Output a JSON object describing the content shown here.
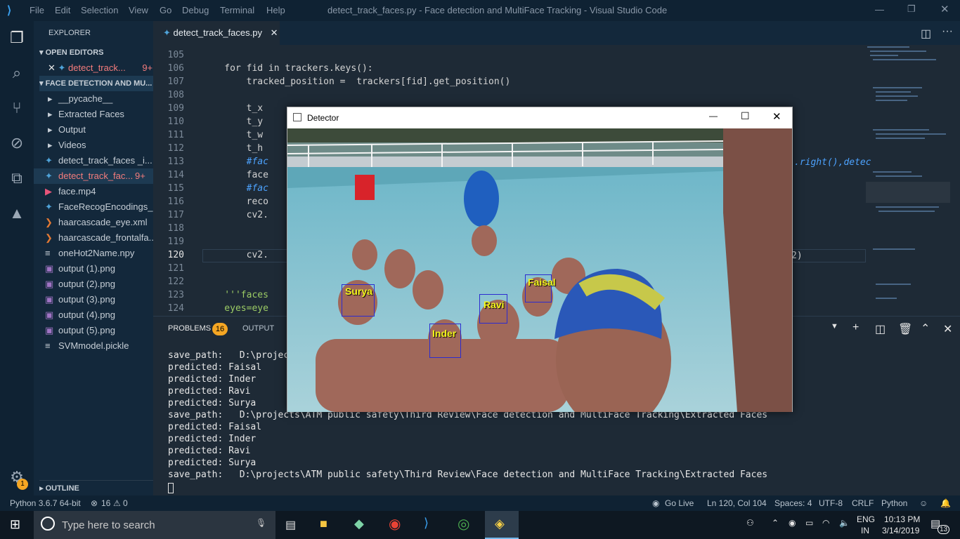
{
  "window": {
    "menu": [
      "File",
      "Edit",
      "Selection",
      "View",
      "Go",
      "Debug",
      "Terminal",
      "Help"
    ],
    "title": "detect_track_faces.py - Face detection and MultiFace Tracking - Visual Studio Code"
  },
  "sidebar": {
    "header": "EXPLORER",
    "open_editors_label": "OPEN EDITORS",
    "open_editor_file": "detect_track...",
    "open_editor_badge": "9+",
    "project_label": "FACE DETECTION AND MU...",
    "items": [
      {
        "label": "__pycache__",
        "icon": "chevron-right"
      },
      {
        "label": "Extracted Faces",
        "icon": "chevron-right"
      },
      {
        "label": "Output",
        "icon": "chevron-right"
      },
      {
        "label": "Videos",
        "icon": "chevron-right"
      },
      {
        "label": "detect_track_faces _i...",
        "icon": "python"
      },
      {
        "label": "detect_track_fac...",
        "icon": "python",
        "badge": "9+"
      },
      {
        "label": "face.mp4",
        "icon": "video"
      },
      {
        "label": "FaceRecogEncodings_...",
        "icon": "python"
      },
      {
        "label": "haarcascade_eye.xml",
        "icon": "xml"
      },
      {
        "label": "haarcascade_frontalfa...",
        "icon": "xml"
      },
      {
        "label": "oneHot2Name.npy",
        "icon": "file"
      },
      {
        "label": "output (1).png",
        "icon": "image"
      },
      {
        "label": "output (2).png",
        "icon": "image"
      },
      {
        "label": "output (3).png",
        "icon": "image"
      },
      {
        "label": "output (4).png",
        "icon": "image"
      },
      {
        "label": "output (5).png",
        "icon": "image"
      },
      {
        "label": "SVMmodel.pickle",
        "icon": "file"
      }
    ],
    "outline_label": "OUTLINE"
  },
  "editor": {
    "tab_label": "detect_track_faces.py",
    "lines": [
      {
        "n": "105",
        "code": ""
      },
      {
        "n": "106",
        "code": "    for fid in trackers.keys():"
      },
      {
        "n": "107",
        "code": "        tracked_position =  trackers[fid].get_position()"
      },
      {
        "n": "108",
        "code": ""
      },
      {
        "n": "109",
        "code": "        t_x"
      },
      {
        "n": "110",
        "code": "        t_y"
      },
      {
        "n": "111",
        "code": "        t_w"
      },
      {
        "n": "112",
        "code": "        t_h"
      },
      {
        "n": "113",
        "code": "        #fac"
      },
      {
        "n": "114",
        "code": "        face"
      },
      {
        "n": "115",
        "code": "        #fac"
      },
      {
        "n": "116",
        "code": "        reco"
      },
      {
        "n": "117",
        "code": "        cv2."
      },
      {
        "n": "118",
        "code": ""
      },
      {
        "n": "119",
        "code": ""
      },
      {
        "n": "120",
        "code": "        cv2."
      },
      {
        "n": "121",
        "code": ""
      },
      {
        "n": "122",
        "code": ""
      },
      {
        "n": "123",
        "code": "    '''faces"
      },
      {
        "n": "124",
        "code": "    eyes=eye"
      }
    ],
    "right_snippet_113": ".right(),detec",
    "right_snippet_120": "2)"
  },
  "panel": {
    "tab_problems": "PROBLEMS",
    "problems_count": "16",
    "tab_output": "OUTPUT",
    "terminal_lines": [
      "save_path:   D:\\projects",
      "predicted: Faisal",
      "predicted: Inder",
      "predicted: Ravi",
      "predicted: Surya",
      "save_path:   D:\\projects\\ATM public safety\\Third Review\\Face detection and MultiFace Tracking\\Extracted Faces",
      "predicted: Faisal",
      "predicted: Inder",
      "predicted: Ravi",
      "predicted: Surya",
      "save_path:   D:\\projects\\ATM public safety\\Third Review\\Face detection and MultiFace Tracking\\Extracted Faces"
    ]
  },
  "statusbar": {
    "python": "Python 3.6.7 64-bit",
    "errors": "16",
    "warnings": "0",
    "golive": "Go Live",
    "position": "Ln 120, Col 104",
    "spaces": "Spaces: 4",
    "encoding": "UTF-8",
    "eol": "CRLF",
    "language": "Python",
    "settings_badge": "1"
  },
  "detector": {
    "title": "Detector",
    "faces": [
      {
        "name": "Surya"
      },
      {
        "name": "Faisal"
      },
      {
        "name": "Ravi"
      },
      {
        "name": "Inder"
      }
    ]
  },
  "taskbar": {
    "search_placeholder": "Type here to search",
    "lang_top": "ENG",
    "lang_bottom": "IN",
    "time": "10:13 PM",
    "date": "3/14/2019",
    "notification_count": "13"
  },
  "colors": {
    "accent": "#0e7acc",
    "face_box": "#2b2bd0",
    "face_label": "#f2f51a",
    "badge": "#f5a623"
  }
}
